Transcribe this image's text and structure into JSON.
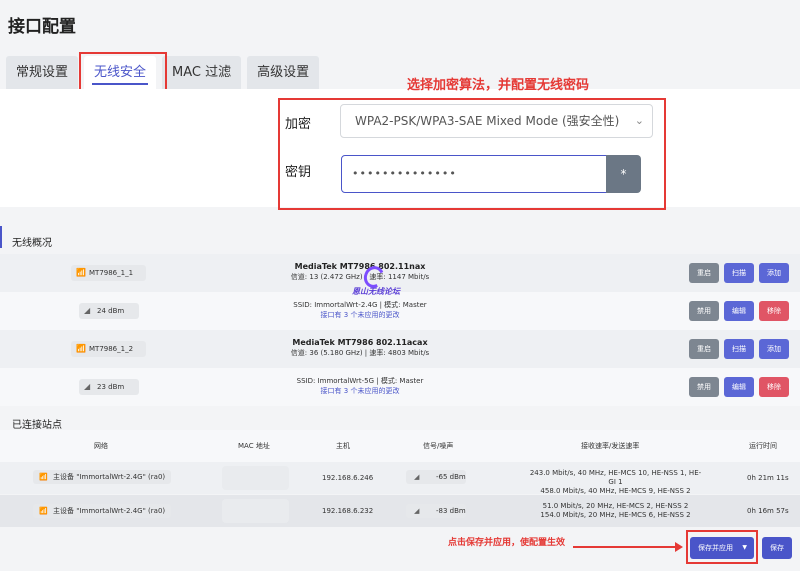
{
  "page_title": "接口配置",
  "tabs": [
    {
      "label": "常规设置",
      "active": false
    },
    {
      "label": "无线安全",
      "active": true
    },
    {
      "label": "MAC 过滤",
      "active": false
    },
    {
      "label": "高级设置",
      "active": false
    }
  ],
  "annotation_top": "选择加密算法，并配置无线密码",
  "form": {
    "encryption_label": "加密",
    "encryption_value": "WPA2-PSK/WPA3-SAE Mixed Mode (强安全性)",
    "key_label": "密钥",
    "key_value": "••••••••••••••",
    "reveal_button": "*"
  },
  "wireless_overview": {
    "title": "无线概况",
    "devices": [
      {
        "device_name": "MT7986_1_1",
        "model": "MediaTek MT7986 802.11nax",
        "channel": "信道: 13 (2.472 GHz) | 速率: 1147 Mbit/s",
        "buttons": [
          "重启",
          "扫描",
          "添加"
        ],
        "iface_power": "24 dBm",
        "ssid": "SSID: ImmortalWrt-2.4G | 模式: Master",
        "pending": "接口有 3 个未应用的更改",
        "iface_buttons": [
          "禁用",
          "编辑",
          "移除"
        ]
      },
      {
        "device_name": "MT7986_1_2",
        "model": "MediaTek MT7986 802.11acax",
        "channel": "信道: 36 (5.180 GHz) | 速率: 4803 Mbit/s",
        "buttons": [
          "重启",
          "扫描",
          "添加"
        ],
        "iface_power": "23 dBm",
        "ssid": "SSID: ImmortalWrt-5G | 模式: Master",
        "pending": "接口有 3 个未应用的更改",
        "iface_buttons": [
          "禁用",
          "编辑",
          "移除"
        ]
      }
    ]
  },
  "watermark": "恩山无线论坛",
  "stations": {
    "title": "已连接站点",
    "headers": [
      "网络",
      "MAC 地址",
      "主机",
      "信号/噪声",
      "接收速率/发送速率",
      "运行时间"
    ],
    "rows": [
      {
        "network": "主设备 \"ImmortalWrt-2.4G\" (ra0)",
        "host": "192.168.6.246",
        "signal": "-65 dBm",
        "rate_rx": "243.0 Mbit/s, 40 MHz, HE-MCS 10, HE-NSS 1, HE-GI 1",
        "rate_tx": "458.0 Mbit/s, 40 MHz, HE-MCS 9, HE-NSS 2",
        "uptime": "0h 21m 11s"
      },
      {
        "network": "主设备 \"ImmortalWrt-2.4G\" (ra0)",
        "host": "192.168.6.232",
        "signal": "-83 dBm",
        "rate_rx": "51.0 Mbit/s, 20 MHz, HE-MCS 2, HE-NSS 2",
        "rate_tx": "154.0 Mbit/s, 20 MHz, HE-MCS 6, HE-NSS 2",
        "uptime": "0h 16m 57s"
      }
    ]
  },
  "annotation_bottom": "点击保存并应用，使配置生效",
  "footer": {
    "save_apply": "保存并应用",
    "save": "保存"
  },
  "colors": {
    "accent": "#4a55c9",
    "highlight": "#e53935",
    "danger": "#e05565",
    "neutral_button": "#7d8691"
  }
}
